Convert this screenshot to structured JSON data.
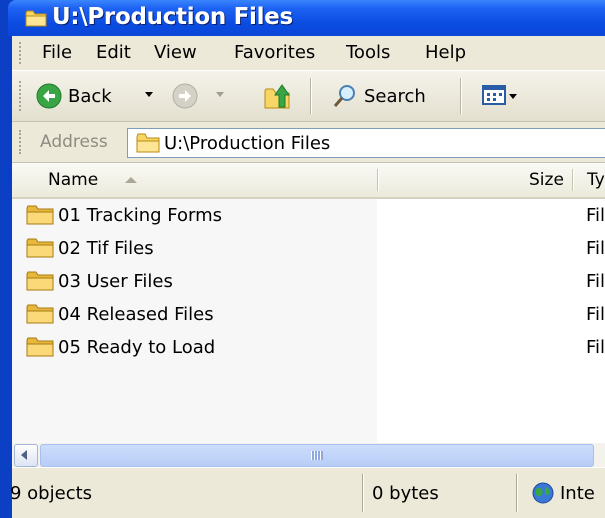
{
  "window": {
    "title": "U:\\Production Files"
  },
  "menu": [
    "File",
    "Edit",
    "View",
    "Favorites",
    "Tools",
    "Help"
  ],
  "toolbar": {
    "back_label": "Back",
    "search_label": "Search"
  },
  "address": {
    "label": "Address",
    "value": "U:\\Production Files"
  },
  "columns": {
    "name": "Name",
    "size": "Size",
    "type": "Ty"
  },
  "files": [
    {
      "name": "01 Tracking Forms",
      "type": "File"
    },
    {
      "name": "02 Tif Files",
      "type": "File"
    },
    {
      "name": "03 User Files",
      "type": "File"
    },
    {
      "name": "04 Released Files",
      "type": "File"
    },
    {
      "name": "05 Ready to Load",
      "type": "File"
    }
  ],
  "status": {
    "objects": "9 objects",
    "size": "0 bytes",
    "zone": "Inte"
  },
  "colors": {
    "titlebar": "#0b47d8",
    "chrome": "#ece9d8",
    "folder": "#f4c84a"
  }
}
